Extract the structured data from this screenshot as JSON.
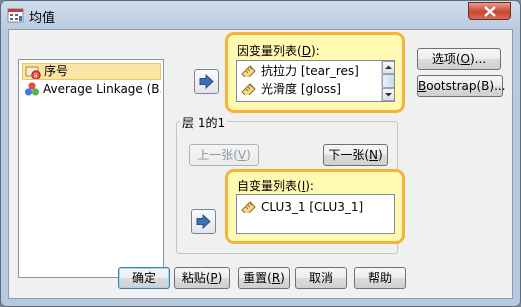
{
  "window": {
    "title": "均值"
  },
  "source_list": {
    "items": [
      {
        "label": "序号",
        "icon": "ruler-scale-icon",
        "selected": true
      },
      {
        "label": "Average Linkage (B...",
        "icon": "nominal-balls-icon",
        "selected": false
      }
    ]
  },
  "dependent": {
    "label_text": "因变量列表(",
    "label_key": "D",
    "label_end": "):",
    "items": [
      {
        "label": "抗拉力 [tear_res]",
        "icon": "ruler-scale-icon"
      },
      {
        "label": "光滑度 [gloss]",
        "icon": "ruler-scale-icon"
      }
    ]
  },
  "layer": {
    "title": "层 1的1",
    "prev_label_text": "上一张(",
    "prev_label_key": "V",
    "prev_label_end": ")",
    "next_label_text": "下一张(",
    "next_label_key": "N",
    "next_label_end": ")"
  },
  "independent": {
    "label_text": "自变量列表(",
    "label_key": "I",
    "label_end": "):",
    "items": [
      {
        "label": "CLU3_1 [CLU3_1]",
        "icon": "ruler-scale-icon"
      }
    ]
  },
  "side_buttons": {
    "options_text": "选项(",
    "options_key": "O",
    "options_end": ")...",
    "bootstrap_text": "",
    "bootstrap_key": "B",
    "bootstrap_end": "ootstrap(B)..."
  },
  "bottom_buttons": {
    "ok": "确定",
    "paste_text": "粘贴(",
    "paste_key": "P",
    "paste_end": ")",
    "reset_text": "重置(",
    "reset_key": "R",
    "reset_end": ")",
    "cancel": "取消",
    "help": "帮助"
  },
  "colors": {
    "highlight_border": "#f4b43a",
    "highlight_fill": "#fff9b2",
    "selection": "#fbe5a6",
    "close_button": "#c8472f",
    "arrow": "#3f6fb5"
  }
}
